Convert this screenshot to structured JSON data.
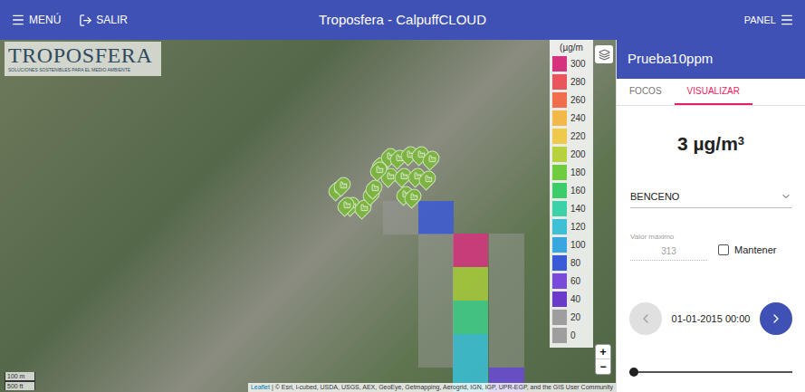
{
  "top_bar": {
    "menu": "MENÚ",
    "exit": "SALIR",
    "title": "Troposfera - CalpuffCLOUD",
    "panel": "PANEL"
  },
  "map": {
    "logo": {
      "name": "TROPOSFERA",
      "tagline": "SOLUCIONES SOSTENIBLES PARA EL MEDIO AMBIENTE"
    },
    "legend": {
      "title": "(µg/m",
      "items": [
        {
          "label": "300",
          "color": "#d6337f"
        },
        {
          "label": "280",
          "color": "#e8555d"
        },
        {
          "label": "260",
          "color": "#ee6e4d"
        },
        {
          "label": "240",
          "color": "#f2b94a"
        },
        {
          "label": "220",
          "color": "#efc94c"
        },
        {
          "label": "200",
          "color": "#b6d13c"
        },
        {
          "label": "180",
          "color": "#6ecc3e"
        },
        {
          "label": "160",
          "color": "#3dcc6a"
        },
        {
          "label": "140",
          "color": "#3dd1a8"
        },
        {
          "label": "120",
          "color": "#3dbfd6"
        },
        {
          "label": "100",
          "color": "#3aa6e0"
        },
        {
          "label": "80",
          "color": "#3a5bd6"
        },
        {
          "label": "60",
          "color": "#7a4ad8"
        },
        {
          "label": "40",
          "color": "#6a3ac8"
        },
        {
          "label": "20",
          "color": "#9e9e9e"
        },
        {
          "label": "0",
          "color": "#9e9e9e"
        }
      ]
    },
    "cells": [
      {
        "color": "#9e9e9e"
      },
      {
        "color": "#3a5bd6"
      },
      {
        "color": "#d6337f"
      },
      {
        "color": "#a8cc3a"
      },
      {
        "color": "#3ecf8a"
      },
      {
        "color": "#3ac1d8"
      },
      {
        "color": "#3ac1d8"
      },
      {
        "color": "#6a4ad8"
      },
      {
        "color": "#9e9e9e"
      },
      {
        "color": "#9e9e9e"
      },
      {
        "color": "#9e9e9e"
      },
      {
        "color": "#9e9e9e"
      },
      {
        "color": "#9e9e9e"
      },
      {
        "color": "#9e9e9e"
      },
      {
        "color": "#9e9e9e"
      },
      {
        "color": "#9e9e9e"
      }
    ],
    "zoom": [
      "+",
      "−"
    ],
    "scale": [
      "100 m",
      "500 ft"
    ],
    "attribution": {
      "link": "Leaflet",
      "text": "| © Esri, i-cubed, USDA, USGS, AEX, GeoEye, Getmapping, Aerogrid, IGN, IGP, UPR-EGP, and the GIS User Community"
    }
  },
  "panel": {
    "title": "Prueba10ppm",
    "tabs": [
      {
        "label": "FOCOS",
        "selected": false
      },
      {
        "label": "VISUALIZAR",
        "selected": true
      }
    ],
    "value": "3",
    "unit": "µg/m",
    "unit_exponent": "3",
    "pollutant": "BENCENO",
    "max_value": {
      "label": "Valor máximo",
      "value": "313",
      "disabled": true
    },
    "keep": {
      "label": "Mantener",
      "checked": false
    },
    "time": {
      "value": "01-01-2015 00:00",
      "prev_disabled": true,
      "next_disabled": false
    },
    "slider": {
      "level": 0
    }
  }
}
